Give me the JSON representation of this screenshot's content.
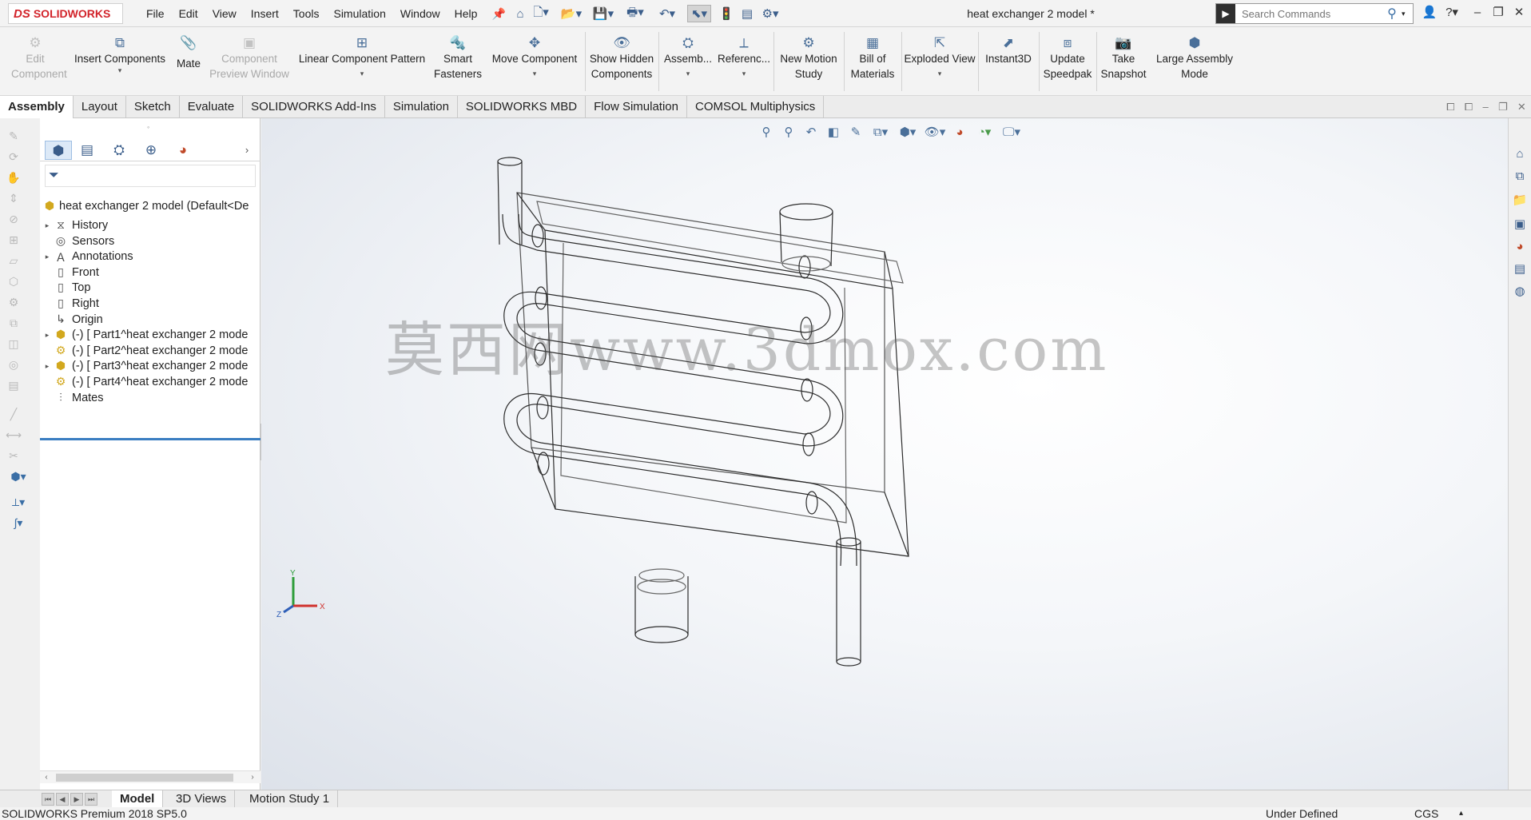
{
  "app": {
    "logo_prefix": "DS",
    "logo_text": "SOLIDWORKS",
    "document_title": "heat exchanger 2 model *"
  },
  "menu": [
    "File",
    "Edit",
    "View",
    "Insert",
    "Tools",
    "Simulation",
    "Window",
    "Help"
  ],
  "search": {
    "placeholder": "Search Commands"
  },
  "ribbon": {
    "edit_component": "Edit Component",
    "insert_components": "Insert Components",
    "mate": "Mate",
    "component_preview": "Component Preview Window",
    "linear_pattern": "Linear Component Pattern",
    "smart_fasteners": "Smart Fasteners",
    "move_component": "Move Component",
    "show_hidden": "Show Hidden Components",
    "assembly_features": "Assemb...",
    "reference_geometry": "Referenc...",
    "new_motion_study": "New Motion Study",
    "bill_of_materials": "Bill of Materials",
    "exploded_view": "Exploded View",
    "instant3d": "Instant3D",
    "update_speedpak": "Update Speedpak",
    "take_snapshot": "Take Snapshot",
    "large_assembly_mode": "Large Assembly Mode"
  },
  "tabs": [
    "Assembly",
    "Layout",
    "Sketch",
    "Evaluate",
    "SOLIDWORKS Add-Ins",
    "Simulation",
    "SOLIDWORKS MBD",
    "Flow Simulation",
    "COMSOL Multiphysics"
  ],
  "tree": {
    "root": "heat exchanger 2 model  (Default<De",
    "items": [
      {
        "label": "History",
        "arrow": "▸"
      },
      {
        "label": "Sensors",
        "arrow": ""
      },
      {
        "label": "Annotations",
        "arrow": "▸"
      },
      {
        "label": "Front",
        "arrow": ""
      },
      {
        "label": "Top",
        "arrow": ""
      },
      {
        "label": "Right",
        "arrow": ""
      },
      {
        "label": "Origin",
        "arrow": ""
      },
      {
        "label": "(-) [ Part1^heat exchanger 2 mode",
        "arrow": "▸"
      },
      {
        "label": "(-) [ Part2^heat exchanger 2 mode",
        "arrow": ""
      },
      {
        "label": "(-) [ Part3^heat exchanger 2 mode",
        "arrow": "▸"
      },
      {
        "label": "(-) [ Part4^heat exchanger 2 mode",
        "arrow": ""
      },
      {
        "label": "Mates",
        "arrow": ""
      }
    ]
  },
  "viewport": {
    "watermark": "莫西网www.3dmox.com",
    "triad": {
      "x": "X",
      "y": "Y",
      "z": "Z"
    }
  },
  "bottom_tabs": [
    "Model",
    "3D Views",
    "Motion Study 1"
  ],
  "status": {
    "version": "SOLIDWORKS Premium 2018 SP5.0",
    "state": "Under Defined",
    "units": "CGS"
  },
  "colors": {
    "brand": "#d2232a",
    "selection": "#3a7ec1",
    "axis_x": "#d0312d",
    "axis_y": "#2e9d3a",
    "axis_z": "#2f5fb8"
  }
}
